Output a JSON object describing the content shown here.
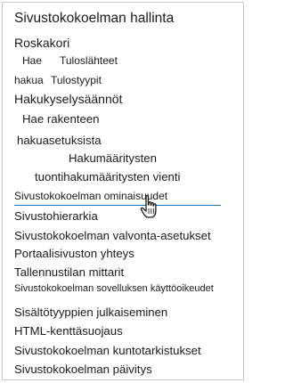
{
  "panel": {
    "title": "Sivustokokoelman hallinta",
    "items": [
      "Roskakori",
      "Hae",
      "Tuloslähteet",
      "hakua",
      "Tulostyypit",
      "Hakukyselysäännöt",
      "Hae rakenteen",
      "hakuasetuksista",
      "Hakumääritysten",
      "tuontihakumääritysten vienti",
      "Sivustokokoelman ominaisuudet",
      "Sivustohierarkia",
      "Sivustokokoelman valvonta-asetukset",
      "Portaalisivuston yhteys",
      "Tallennustilan mittarit",
      "Sivustokokoelman sovelluksen käyttöoikeudet",
      "Sisältötyyppien julkaiseminen",
      "HTML-kenttäsuojaus",
      "Sivustokokoelman kuntotarkistukset",
      "Sivustokokoelman päivitys"
    ]
  },
  "cursor": {
    "type": "hand-pointer-icon"
  }
}
